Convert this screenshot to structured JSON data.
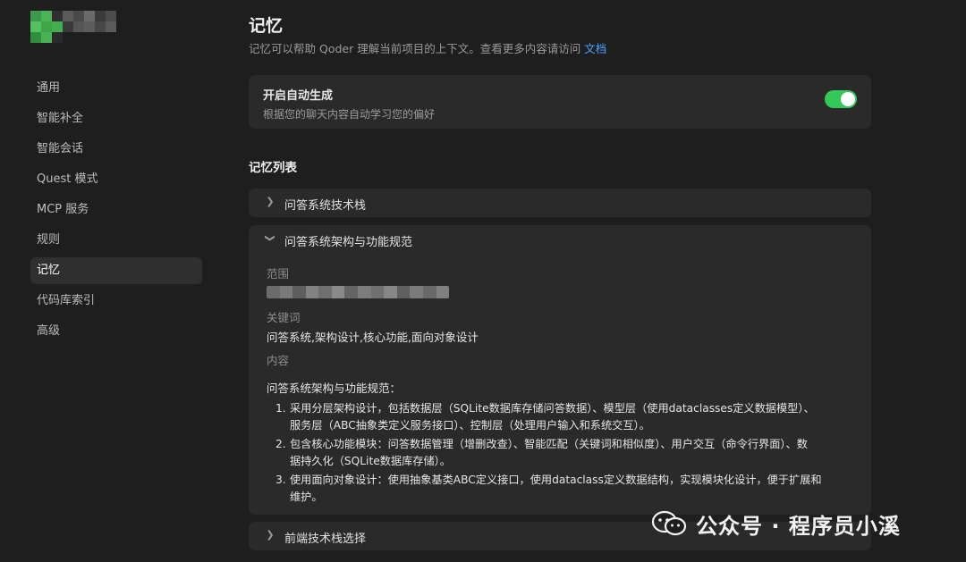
{
  "sidebar": {
    "items": [
      {
        "label": "通用",
        "active": false
      },
      {
        "label": "智能补全",
        "active": false
      },
      {
        "label": "智能会话",
        "active": false
      },
      {
        "label": "Quest 模式",
        "active": false
      },
      {
        "label": "MCP 服务",
        "active": false
      },
      {
        "label": "规则",
        "active": false
      },
      {
        "label": "记忆",
        "active": true
      },
      {
        "label": "代码库索引",
        "active": false
      },
      {
        "label": "高级",
        "active": false
      }
    ]
  },
  "header": {
    "title": "记忆",
    "description": "记忆可以帮助 Qoder 理解当前项目的上下文。查看更多内容请访问",
    "link": "文档"
  },
  "auto_generate": {
    "title": "开启自动生成",
    "subtitle": "根据您的聊天内容自动学习您的偏好",
    "enabled": true
  },
  "memory_list": {
    "title": "记忆列表",
    "items": [
      {
        "title": "问答系统技术栈",
        "expanded": false
      },
      {
        "title": "问答系统架构与功能规范",
        "expanded": true,
        "scope_label": "范围",
        "keywords_label": "关键词",
        "keywords": "问答系统,架构设计,核心功能,面向对象设计",
        "content_label": "内容",
        "content_intro": "问答系统架构与功能规范：",
        "content_points": [
          {
            "num": "1.",
            "line1": "采用分层架构设计，包括数据层（SQLite数据库存储问答数据）、模型层（使用dataclasses定义数据模型）、",
            "line2": "服务层（ABC抽象类定义服务接口）、控制层（处理用户输入和系统交互）。"
          },
          {
            "num": "2.",
            "line1": "包含核心功能模块：问答数据管理（增删改查）、智能匹配（关键词和相似度）、用户交互（命令行界面）、数",
            "line2": "据持久化（SQLite数据库存储）。"
          },
          {
            "num": "3.",
            "line1": "使用面向对象设计：使用抽象基类ABC定义接口，使用dataclass定义数据结构，实现模块化设计，便于扩展和",
            "line2": "维护。"
          }
        ]
      },
      {
        "title": "前端技术栈选择",
        "expanded": false
      }
    ]
  },
  "watermark": {
    "text": "公众号 · 程序员小溪"
  },
  "colors": {
    "background": "#1e1e1e",
    "card": "#2a2a2a",
    "toggle_on": "#34c759",
    "link": "#4aa3ff"
  }
}
